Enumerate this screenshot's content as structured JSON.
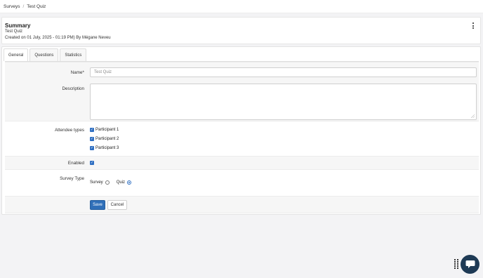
{
  "breadcrumb": {
    "root": "Surveys",
    "separator": "/",
    "current": "Test Quiz"
  },
  "summary": {
    "title": "Summary",
    "name": "Test Quiz",
    "created": "Created on 01 July, 2025 - 01:19 PM) By Mégane Neveu"
  },
  "tabs": [
    {
      "label": "General",
      "active": true
    },
    {
      "label": "Questions",
      "active": false
    },
    {
      "label": "Statistics",
      "active": false
    }
  ],
  "form": {
    "name_label": "Name*",
    "name_value": "Test Quiz",
    "description_label": "Description",
    "description_value": "",
    "attendee_label": "Attendee types",
    "attendees": [
      {
        "label": "Participant 1",
        "checked": true
      },
      {
        "label": "Participant 2",
        "checked": true
      },
      {
        "label": "Participant 3",
        "checked": true
      }
    ],
    "enabled_label": "Enabled",
    "enabled": true,
    "survey_type_label": "Survey Type",
    "survey_type_options": [
      {
        "label": "Survey",
        "selected": false
      },
      {
        "label": "Quiz",
        "selected": true
      }
    ],
    "save_label": "Save",
    "cancel_label": "Cancel"
  },
  "colors": {
    "primary": "#2f6fb8",
    "chat_bg": "#1e3a55"
  },
  "icons": {
    "menu": "kebab-menu-icon",
    "chat": "chat-bubble-icon",
    "drag": "drag-handle-icon"
  }
}
